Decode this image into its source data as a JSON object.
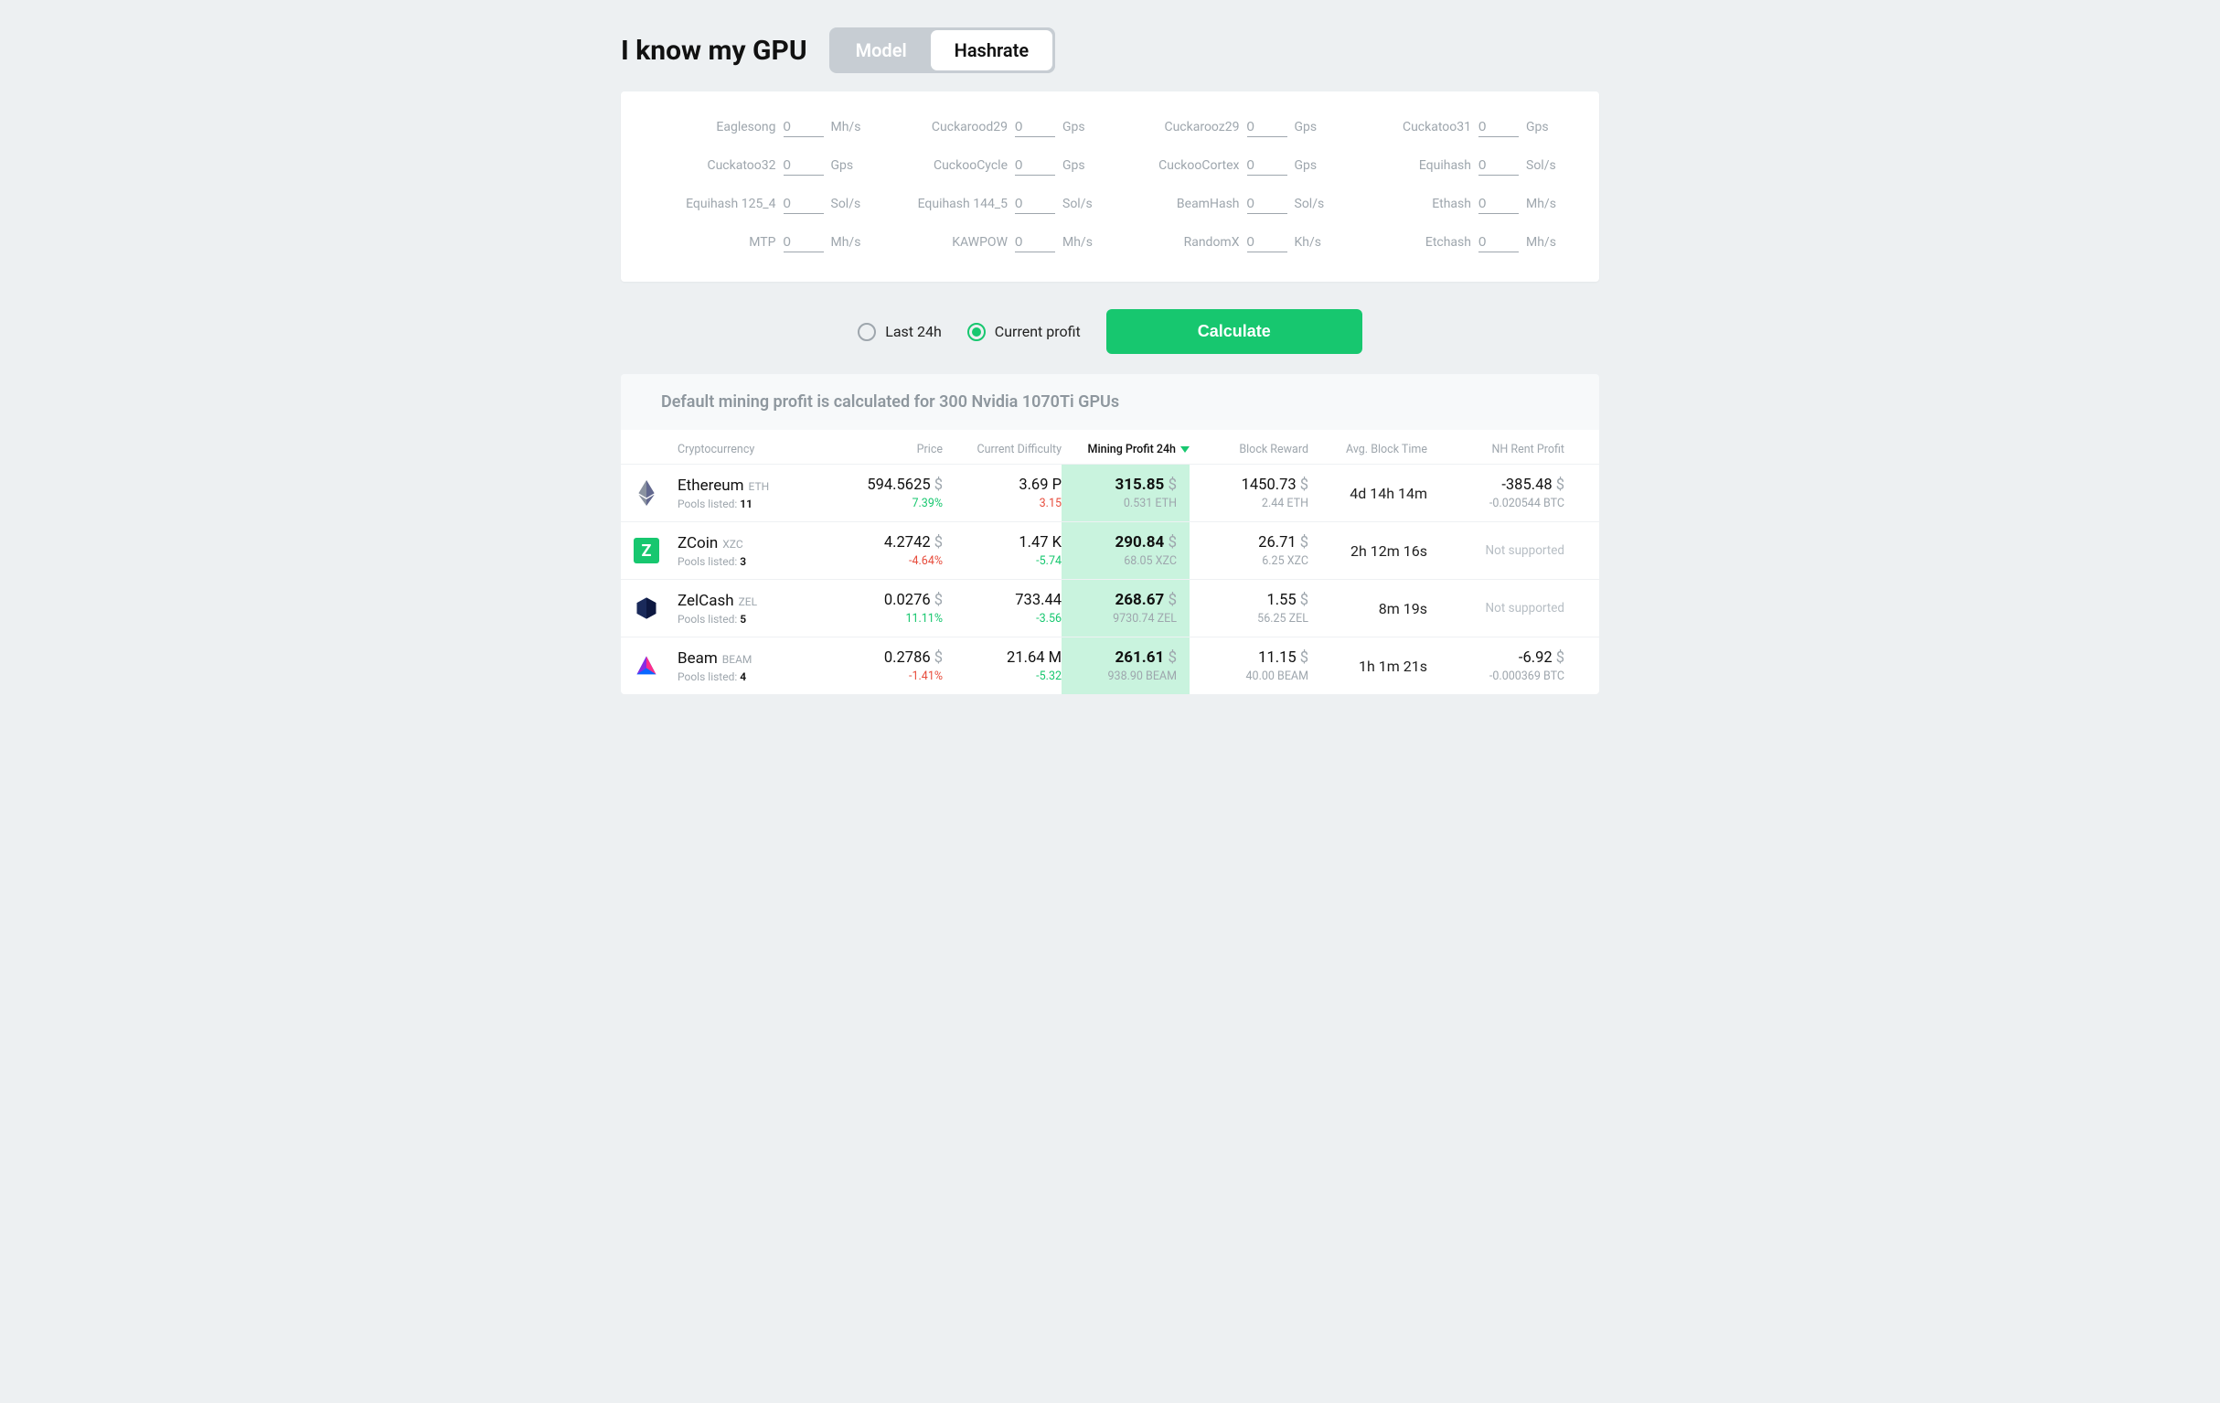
{
  "header": {
    "title": "I know my GPU",
    "toggle": {
      "model": "Model",
      "hashrate": "Hashrate"
    }
  },
  "hashrates": [
    {
      "label": "Eaglesong",
      "value": "0",
      "unit": "Mh/s"
    },
    {
      "label": "Cuckarood29",
      "value": "0",
      "unit": "Gps"
    },
    {
      "label": "Cuckarooz29",
      "value": "0",
      "unit": "Gps"
    },
    {
      "label": "Cuckatoo31",
      "value": "0",
      "unit": "Gps"
    },
    {
      "label": "Cuckatoo32",
      "value": "0",
      "unit": "Gps"
    },
    {
      "label": "CuckooCycle",
      "value": "0",
      "unit": "Gps"
    },
    {
      "label": "CuckooCortex",
      "value": "0",
      "unit": "Gps"
    },
    {
      "label": "Equihash",
      "value": "0",
      "unit": "Sol/s"
    },
    {
      "label": "Equihash 125_4",
      "value": "0",
      "unit": "Sol/s"
    },
    {
      "label": "Equihash 144_5",
      "value": "0",
      "unit": "Sol/s"
    },
    {
      "label": "BeamHash",
      "value": "0",
      "unit": "Sol/s"
    },
    {
      "label": "Ethash",
      "value": "0",
      "unit": "Mh/s"
    },
    {
      "label": "MTP",
      "value": "0",
      "unit": "Mh/s"
    },
    {
      "label": "KAWPOW",
      "value": "0",
      "unit": "Mh/s"
    },
    {
      "label": "RandomX",
      "value": "0",
      "unit": "Kh/s"
    },
    {
      "label": "Etchash",
      "value": "0",
      "unit": "Mh/s"
    }
  ],
  "controls": {
    "last24h": "Last 24h",
    "current": "Current profit",
    "calculate": "Calculate"
  },
  "notice": "Default mining profit is calculated for 300 Nvidia 1070Ti GPUs",
  "columns": {
    "crypto": "Cryptocurrency",
    "price": "Price",
    "diff": "Current Difficulty",
    "profit": "Mining Profit 24h",
    "reward": "Block Reward",
    "blocktime": "Avg. Block Time",
    "nh": "NH Rent Profit"
  },
  "rows": [
    {
      "icon": "eth",
      "name": "Ethereum",
      "sym": "ETH",
      "pools_label": "Pools listed:",
      "pools": "11",
      "price": "594.5625",
      "price_chg": "7.39%",
      "price_dir": "pos",
      "diff": "3.69 P",
      "diff_chg": "3.15",
      "diff_dir": "neg",
      "profit": "315.85",
      "profit_sub": "0.531 ETH",
      "reward": "1450.73",
      "reward_sub": "2.44 ETH",
      "blocktime": "4d 14h 14m",
      "nh_main": "-385.48",
      "nh_sub": "-0.020544 BTC",
      "nh_supported": true
    },
    {
      "icon": "zcoin",
      "name": "ZCoin",
      "sym": "XZC",
      "pools_label": "Pools listed:",
      "pools": "3",
      "price": "4.2742",
      "price_chg": "-4.64%",
      "price_dir": "neg",
      "diff": "1.47 K",
      "diff_chg": "-5.74",
      "diff_dir": "pos",
      "profit": "290.84",
      "profit_sub": "68.05 XZC",
      "reward": "26.71",
      "reward_sub": "6.25 XZC",
      "blocktime": "2h 12m 16s",
      "nh_main": "Not supported",
      "nh_sub": "",
      "nh_supported": false
    },
    {
      "icon": "zel",
      "name": "ZelCash",
      "sym": "ZEL",
      "pools_label": "Pools listed:",
      "pools": "5",
      "price": "0.0276",
      "price_chg": "11.11%",
      "price_dir": "pos",
      "diff": "733.44",
      "diff_chg": "-3.56",
      "diff_dir": "pos",
      "profit": "268.67",
      "profit_sub": "9730.74 ZEL",
      "reward": "1.55",
      "reward_sub": "56.25 ZEL",
      "blocktime": "8m 19s",
      "nh_main": "Not supported",
      "nh_sub": "",
      "nh_supported": false
    },
    {
      "icon": "beam",
      "name": "Beam",
      "sym": "BEAM",
      "pools_label": "Pools listed:",
      "pools": "4",
      "price": "0.2786",
      "price_chg": "-1.41%",
      "price_dir": "neg",
      "diff": "21.64 M",
      "diff_chg": "-5.32",
      "diff_dir": "pos",
      "profit": "261.61",
      "profit_sub": "938.90 BEAM",
      "reward": "11.15",
      "reward_sub": "40.00 BEAM",
      "blocktime": "1h 1m 21s",
      "nh_main": "-6.92",
      "nh_sub": "-0.000369 BTC",
      "nh_supported": true
    }
  ]
}
